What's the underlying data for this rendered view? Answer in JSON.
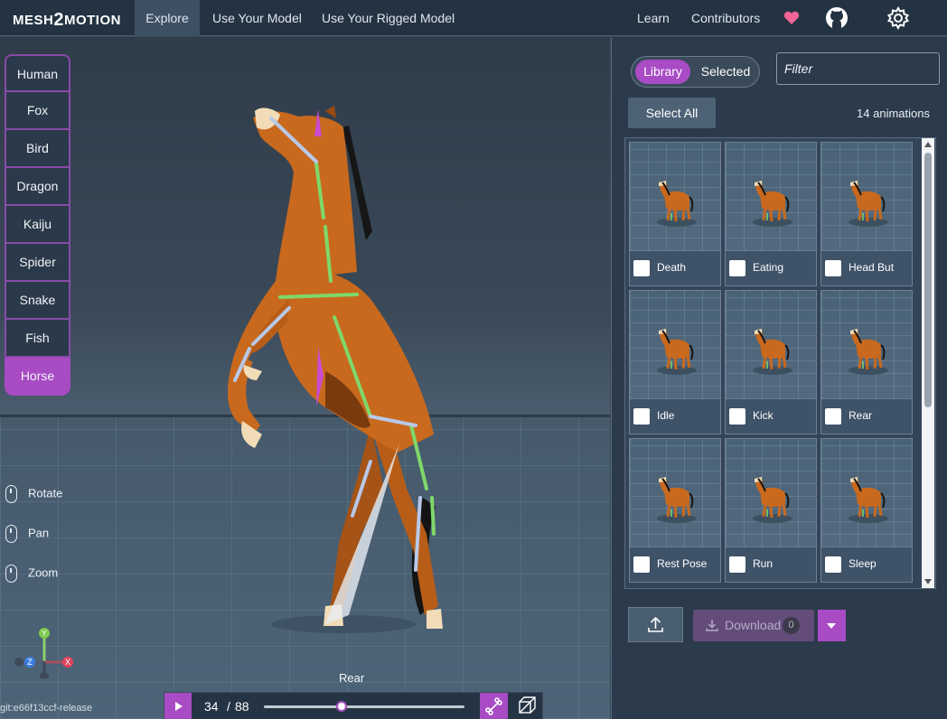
{
  "nav": {
    "logo_left": "MESH",
    "logo_mid": "2",
    "logo_right": "MOTION",
    "links": [
      "Explore",
      "Use Your Model",
      "Use Your Rigged Model"
    ],
    "right_links": [
      "Learn",
      "Contributors"
    ],
    "icons": [
      "heart-icon",
      "github-icon",
      "settings-gear-icon"
    ]
  },
  "skeletons": [
    "Human",
    "Fox",
    "Bird",
    "Dragon",
    "Kaiju",
    "Spider",
    "Snake",
    "Fish",
    "Horse"
  ],
  "active_skeleton": "Horse",
  "mouse_help": [
    "Rotate",
    "Pan",
    "Zoom"
  ],
  "gizmo": {
    "x": "X",
    "y": "Y",
    "z": "Z"
  },
  "git_label": "git:e66f13ccf-release",
  "current_animation": "Rear",
  "playback": {
    "current_frame": "34",
    "separator": "/",
    "total_frames": "88",
    "progress": 0.386
  },
  "panel": {
    "toggle_library": "Library",
    "toggle_selected": "Selected",
    "filter_placeholder": "Filter",
    "select_all": "Select All",
    "count_text": "14 animations",
    "animations": [
      "Death",
      "Eating",
      "Head But",
      "Idle",
      "Kick",
      "Rear",
      "Rest Pose",
      "Run",
      "Sleep"
    ],
    "download_label": "Download",
    "download_count": "0"
  },
  "colors": {
    "accent": "#a84bc4",
    "panel_bg": "#2c3b4b",
    "nav_bg": "#243342",
    "horse_body": "#c8691e"
  }
}
